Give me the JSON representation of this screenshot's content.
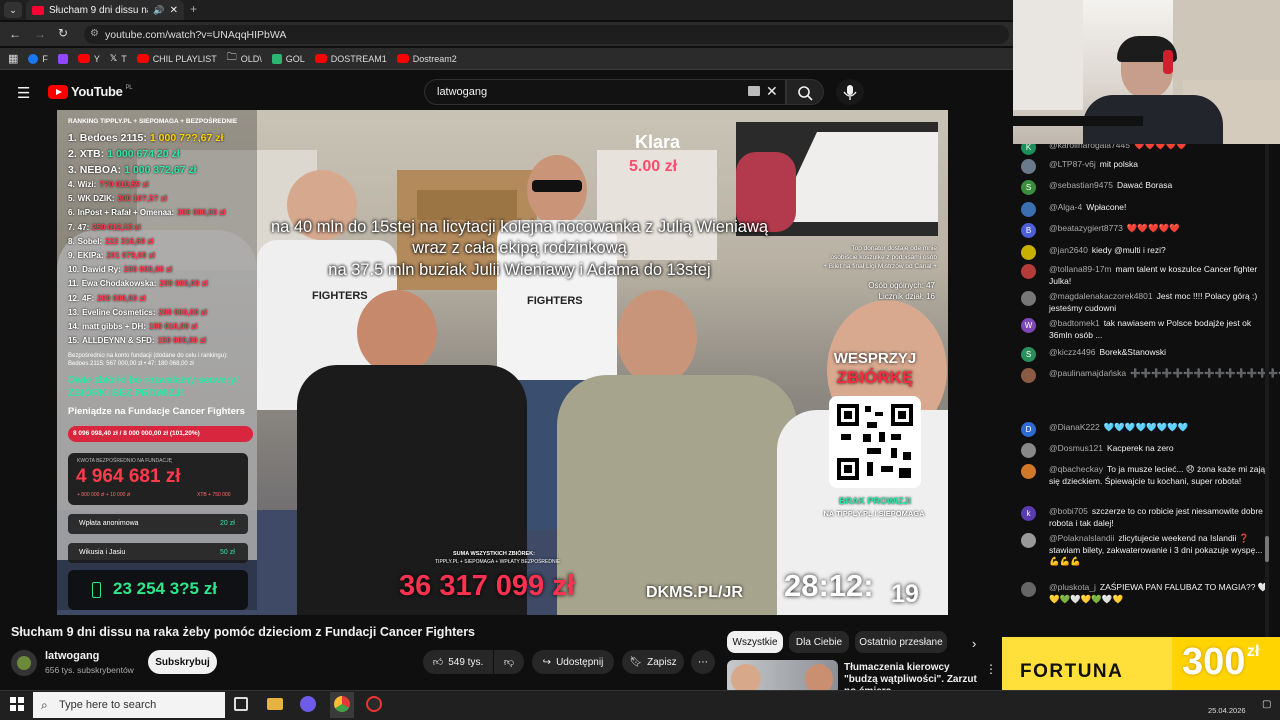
{
  "browser": {
    "tab_title": "Słucham 9 dni dissu na raka żeby",
    "url": "youtube.com/watch?v=UNAqqHIPbWA",
    "bookmarks": [
      "F",
      "Y",
      "T",
      "CHIL PLAYLIST",
      "OLD\\",
      "GOL",
      "DOSTREAM1",
      "Dostream2"
    ]
  },
  "youtube": {
    "logo_text": "YouTube",
    "logo_region": "PL",
    "search_value": "latwogang"
  },
  "video_overlay": {
    "ranking_header": "RANKING TIPPLY.PL + SIEPOMAGA + BEZPOŚREDNIE",
    "ranking": [
      {
        "rank": "1.",
        "name": "Bedoes 2115:",
        "amount": "1 000 7??,67 zł"
      },
      {
        "rank": "2.",
        "name": "XTB:",
        "amount": "1 000 674,20 zł"
      },
      {
        "rank": "3.",
        "name": "NEBOA:",
        "amount": "1 000 372,67 zł"
      },
      {
        "rank": "4.",
        "name": "Wizi:",
        "amount": "??0 010,59 zł"
      },
      {
        "rank": "5.",
        "name": "WK DZIK:",
        "amount": "300 10?,5? zł"
      },
      {
        "rank": "6.",
        "name": "InPost + Rafał + Omenaa:",
        "amount": "300 000,00 zł"
      },
      {
        "rank": "7.",
        "name": "47:",
        "amount": "250 012,13 zł"
      },
      {
        "rank": "8.",
        "name": "Sobel:",
        "amount": "222 316,69 zł"
      },
      {
        "rank": "9.",
        "name": "EKIPa:",
        "amount": "201 079,00 zł"
      },
      {
        "rank": "10.",
        "name": "Dawid Ry:",
        "amount": "200 000,00 zł"
      },
      {
        "rank": "11.",
        "name": "Ewa Chodakowska:",
        "amount": "200 000,00 zł"
      },
      {
        "rank": "12.",
        "name": "4F:",
        "amount": "200 000,00 zł"
      },
      {
        "rank": "13.",
        "name": "Eveline Cosmetics:",
        "amount": "200 000,00 zł"
      },
      {
        "rank": "14.",
        "name": "matt gibbs + DH:",
        "amount": "190 010,00 zł"
      },
      {
        "rank": "15.",
        "name": "ALLDEYNN & SFD:",
        "amount": "150 000,00 zł"
      }
    ],
    "direct_note": "Bezpośrednio na konto fundacji (dodane do celu i rankingu):",
    "direct_note2": "Bedoes 2115: 567 000,00 zł • 47: 180 068,00 zł",
    "servers_line1": "Dwie zbiórki bo rozwalamy serwery!",
    "servers_line2": "ZBIÓRKI BEZ PROWIZJI",
    "foundation_label": "Pieniądze na Fundacje Cancer Fighters",
    "goal_progress": "8 096 098,40 zł / 8 000 000,00 zł (101,20%)",
    "goal_fraction": 1.012,
    "direct_label": "KWOTA BEZPOŚREDNIO NA FUNDACJĘ",
    "direct_amount": "4 964 681 zł",
    "direct_small_left": "+ 800 000 zł   + 10 000 zł",
    "direct_small_right": "XTB  + 750 000",
    "donation1_name": "Wpłata anonimowa",
    "donation1_amount": "20 zł",
    "donation2_name": "Wikusia i Jasiu",
    "donation2_amount": "50 zł",
    "small_counter": "23 254 3?5 zł",
    "donator_name": "Klara",
    "donator_amount": "5.00 zł",
    "caption_line1": "na 40 mln do 15stej na licytacji kolejna nocowanka z Julią Wieniawą",
    "caption_line2": "wraz z cała ekipą rodzinkową",
    "caption_line3": "na 37.5 mln buziak Julii Wieniawy i Adama do 13stej",
    "top_donator_line1": "Top donator dostaje ode mnie",
    "top_donator_line2": "osobiście koszulkę z podpisami osób",
    "top_donator_line3": "+ Bilet na finał Ligi Mistrzów od Canal +",
    "people_count": "Osób ogólnych: 47",
    "counter_label": "Licznik dział: 16",
    "wesprzyj_line1": "WESPRZYJ",
    "wesprzyj_line2": "ZBIÓRKĘ",
    "brak_prowizji": "BRAK PROWIZJI",
    "na_tipply": "NA TIPPLY.PL I SIEPOMAGA",
    "sum_label": "SUMA WSZYSTKICH ZBIÓREK:",
    "sum_sub": "TIPPLY.PL + SIEPOMAGA + WPŁATY BEZPOŚREDNIE",
    "sum_amount": "36 317 099 zł",
    "dkms": "DKMS.PL/JR",
    "timer": "28:12:",
    "timer_sec": "19",
    "shirt_text": "FIGHTERS",
    "shirt_text2": "FIGHTERS"
  },
  "video_info": {
    "title": "Słucham 9 dni dissu na raka żeby pomóc dzieciom z Fundacji Cancer Fighters",
    "channel": "latwogang",
    "subscribers": "656 tys. subskrybentów",
    "subscribe": "Subskrybuj",
    "likes": "549 tys.",
    "share": "Udostępnij",
    "save": "Zapisz",
    "more": "⋯"
  },
  "related": {
    "chips": [
      "Wszystkie",
      "Dla Ciebie",
      "Ostatnio przesłane"
    ],
    "item_title": "Tłumaczenia kierowcy \"budzą wątpliwości\". Zarzut po śmierc...",
    "item_more": "⋮"
  },
  "chat": [
    {
      "author": "@karolinarogala7445",
      "text": "❤️❤️❤️❤️❤️",
      "avatar_letter": "K",
      "avatar_color": "#1e8e5a"
    },
    {
      "author": "@LTP87-v6j",
      "text": "mit polska",
      "avatar_letter": "",
      "avatar_color": "#6b7a8a"
    },
    {
      "author": "@sebastian9475",
      "text": "Dawać Borasa",
      "avatar_letter": "S",
      "avatar_color": "#3b8d3e"
    },
    {
      "author": "@Alga-4",
      "text": "Wpłacone!",
      "avatar_letter": "",
      "avatar_color": "#3a6fb0"
    },
    {
      "author": "@beatazygiert8773",
      "text": "❤️❤️❤️❤️❤️",
      "avatar_letter": "B",
      "avatar_color": "#4c5fd6"
    },
    {
      "author": "@jan2640",
      "text": "kiedy @multi i rezi?",
      "avatar_letter": "",
      "avatar_color": "#c8b000"
    },
    {
      "author": "@tollana89-17m",
      "text": "mam talent w koszulce Cancer fighter Julka!",
      "avatar_letter": "",
      "avatar_color": "#b53a3a"
    },
    {
      "author": "@magdalenakaczorek4801",
      "text": "Jest moc !!!! Polacy górą :) jesteśmy cudowni",
      "avatar_letter": "",
      "avatar_color": "#777777"
    },
    {
      "author": "@badtomek1",
      "text": "tak nawiasem w Polsce bodajże jest ok 36mln osób ...",
      "avatar_letter": "W",
      "avatar_color": "#7d47b5"
    },
    {
      "author": "@kiczz4496",
      "text": "Borek&Stanowski",
      "avatar_letter": "S",
      "avatar_color": "#2a8f5b"
    },
    {
      "author": "@paulinamajdańska",
      "text": "➕➕➕➕➕➕➕➕➕➕➕➕➕➕➕➕",
      "avatar_letter": "",
      "avatar_color": "#8a5a44"
    },
    {
      "author": "@DianaK222",
      "text": "🩵🩵🩵🩵🩵🩵🩵🩵",
      "avatar_letter": "D",
      "avatar_color": "#2c6bd1"
    },
    {
      "author": "@Dosmus121",
      "text": "Kacperek na zero",
      "avatar_letter": "",
      "avatar_color": "#888888"
    },
    {
      "author": "@qbacheckay",
      "text": "To ja musze lecieć... 😞 żona każe mi zająć się dzieckiem. Śpiewajcie tu kochani, super robota!",
      "avatar_letter": "",
      "avatar_color": "#d0772a"
    },
    {
      "author": "@bobi705",
      "text": "szczerze to co robicie jest niesamowite dobre robota i tak dalej!",
      "avatar_letter": "k",
      "avatar_color": "#5b3cb0"
    },
    {
      "author": "@Polaknalslandii",
      "text": "zlicytujecie weekend na Islandii ❓ stawiam bilety, zakwaterowanie i 3 dni pokazuje wyspę... 💪💪💪",
      "avatar_letter": "",
      "avatar_color": "#999999"
    },
    {
      "author": "@pluskota_j",
      "text": "ZAŚPIEWA PAN FALUBAZ TO MAGIA?? 🤍💛💚🤍💛💚🤍💛",
      "avatar_letter": "",
      "avatar_color": "#666666"
    }
  ],
  "ad": {
    "brand": "FORTUNA",
    "amount": "300",
    "currency": "zł"
  },
  "taskbar": {
    "search_placeholder": "Type here to search",
    "date": "25.04.2026"
  }
}
